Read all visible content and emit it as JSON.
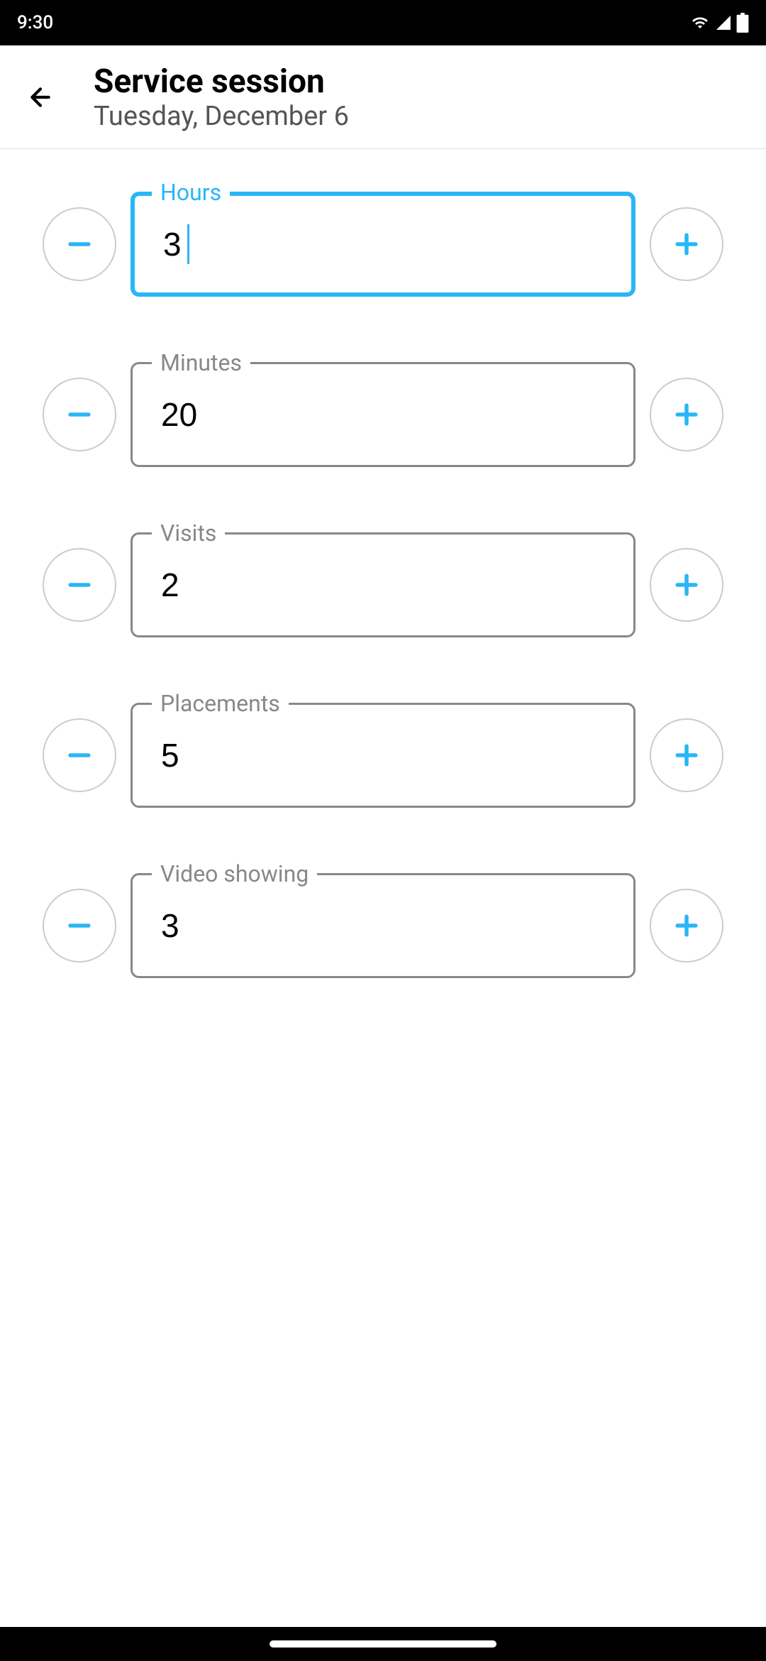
{
  "status": {
    "time": "9:30"
  },
  "header": {
    "title": "Service session",
    "subtitle": "Tuesday, December 6"
  },
  "fields": {
    "hours": {
      "label": "Hours",
      "value": "3"
    },
    "minutes": {
      "label": "Minutes",
      "value": "20"
    },
    "visits": {
      "label": "Visits",
      "value": "2"
    },
    "placements": {
      "label": "Placements",
      "value": "5"
    },
    "video": {
      "label": "Video showing",
      "value": "3"
    }
  },
  "colors": {
    "accent": "#29b6f6",
    "border": "#888888",
    "stepperBorder": "#cccccc"
  }
}
